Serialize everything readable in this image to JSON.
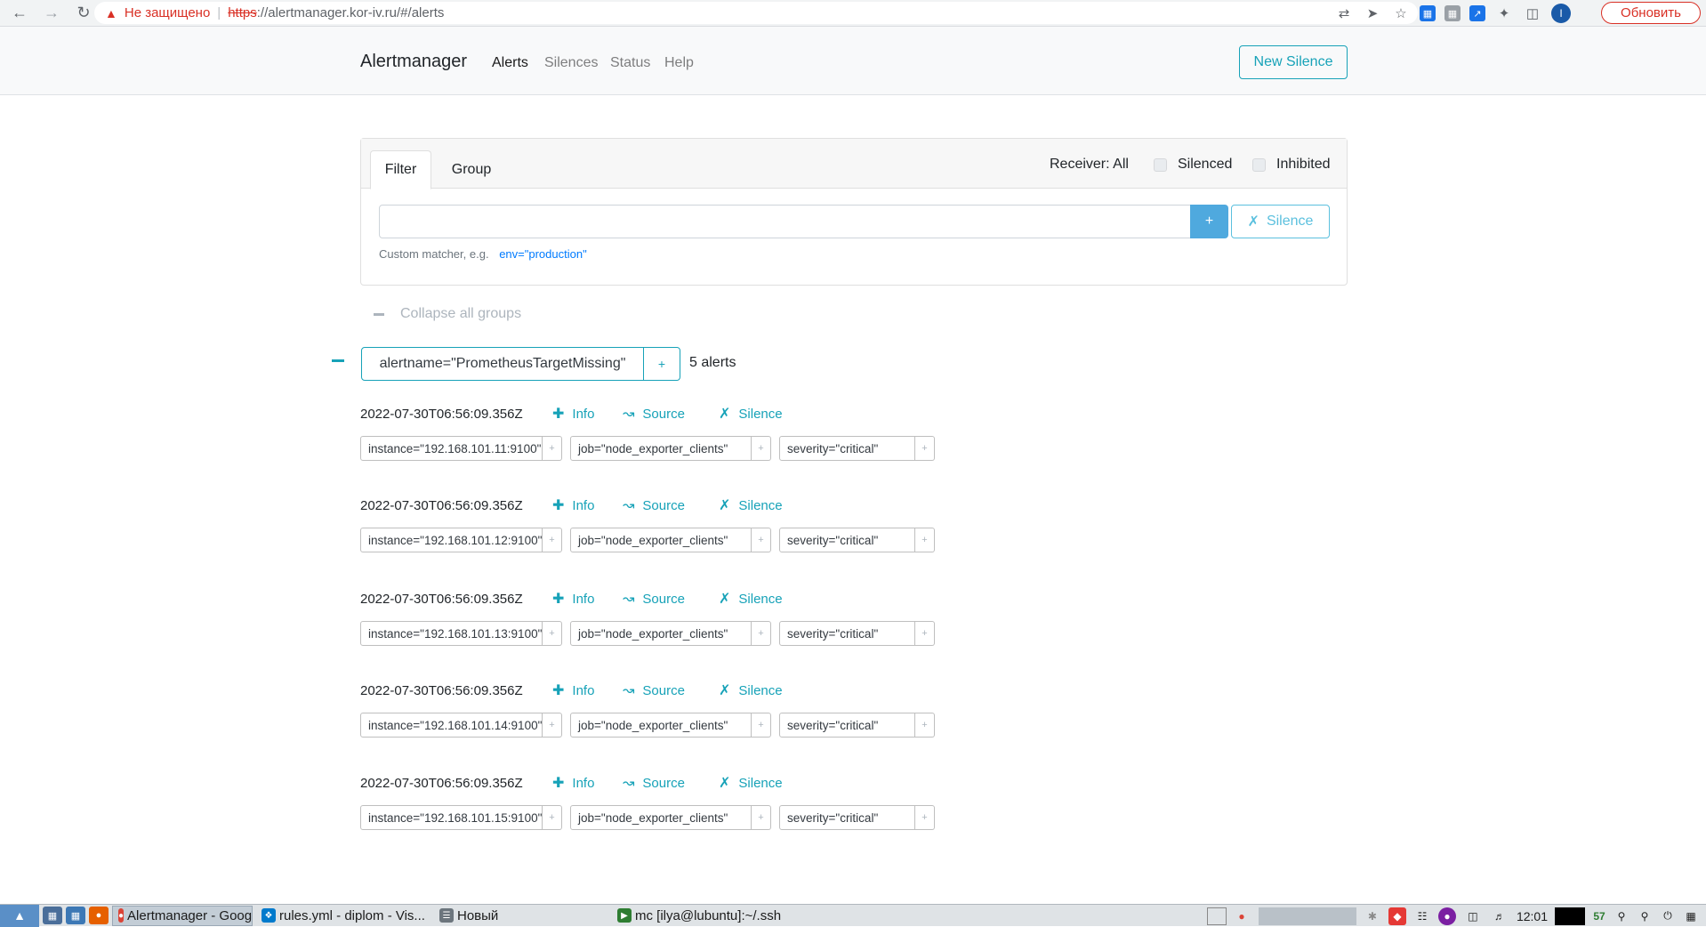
{
  "browser": {
    "security_label": "Не защищено",
    "url_scheme": "https",
    "url_rest": "://alertmanager.kor-iv.ru/#/alerts",
    "profile_initial": "I",
    "update_button": "Обновить"
  },
  "navbar": {
    "brand": "Alertmanager",
    "links": [
      "Alerts",
      "Silences",
      "Status",
      "Help"
    ],
    "active_link": "Alerts",
    "new_silence": "New Silence"
  },
  "filter": {
    "tabs": [
      "Filter",
      "Group"
    ],
    "active_tab": "Filter",
    "receiver": "Receiver: All",
    "silenced_label": "Silenced",
    "inhibited_label": "Inhibited",
    "input_value": "",
    "add_button": "+",
    "silence_button": "Silence",
    "helper_text": "Custom matcher, e.g.",
    "helper_example": "env=\"production\""
  },
  "collapse_all": "Collapse all groups",
  "group": {
    "label": "alertname=\"PrometheusTargetMissing\"",
    "add_button": "+",
    "count": "5 alerts"
  },
  "alert_actions": {
    "info": "Info",
    "source": "Source",
    "silence": "Silence"
  },
  "alerts": [
    {
      "timestamp": "2022-07-30T06:56:09.356Z",
      "labels": [
        "instance=\"192.168.101.11:9100\"",
        "job=\"node_exporter_clients\"",
        "severity=\"critical\""
      ]
    },
    {
      "timestamp": "2022-07-30T06:56:09.356Z",
      "labels": [
        "instance=\"192.168.101.12:9100\"",
        "job=\"node_exporter_clients\"",
        "severity=\"critical\""
      ]
    },
    {
      "timestamp": "2022-07-30T06:56:09.356Z",
      "labels": [
        "instance=\"192.168.101.13:9100\"",
        "job=\"node_exporter_clients\"",
        "severity=\"critical\""
      ]
    },
    {
      "timestamp": "2022-07-30T06:56:09.356Z",
      "labels": [
        "instance=\"192.168.101.14:9100\"",
        "job=\"node_exporter_clients\"",
        "severity=\"critical\""
      ]
    },
    {
      "timestamp": "2022-07-30T06:56:09.356Z",
      "labels": [
        "instance=\"192.168.101.15:9100\"",
        "job=\"node_exporter_clients\"",
        "severity=\"critical\""
      ]
    }
  ],
  "taskbar": {
    "tasks": [
      "Alertmanager - Google...",
      "rules.yml - diplom - Vis...",
      "Новый",
      "mc [ilya@lubuntu]:~/.ssh"
    ],
    "active_task": "Alertmanager - Google...",
    "battery": "57",
    "clock": "12:01"
  },
  "colors": {
    "accent": "#17a2b8",
    "filter_add_bg": "#4fa9de",
    "insecure": "#d93025"
  }
}
